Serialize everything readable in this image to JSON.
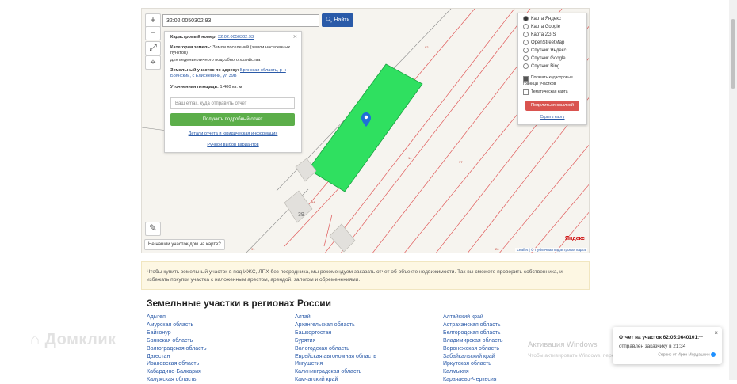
{
  "map": {
    "search_value": "32:02:0050302:93",
    "search_button": "Найти",
    "zoom_in": "+",
    "zoom_out": "−",
    "not_found_button": "Не нашли участок/дом на карте?",
    "parcel_numbers": [
      "92",
      "14",
      "97",
      "94",
      "91",
      "26"
    ],
    "house_number": "39",
    "attribution": "Leaflet | © Публичная кадастровая карта",
    "yandex_logo": "Яндекс",
    "parcel_color": "#2fe060"
  },
  "info": {
    "cadastral_label": "Кадастровый номер:",
    "cadastral_value": "32:02:0050302:93",
    "category_label": "Категория земель:",
    "category_value": "Земли поселений (земли населенных пунктов)",
    "usage": "для ведения личного подсобного хозяйства",
    "address_label": "Земельный участок по адресу:",
    "address_value": "Брянская область, р-н Брянский, с Елисеевичи, ул 39В",
    "area_label": "Уточненная площадь:",
    "area_value": "1 400 кв. м",
    "email_placeholder": "Ваш email, куда отправить отчет",
    "report_button": "Получить подробный отчет",
    "details_link": "Детали отчета и юридическая информация",
    "manual_link": "Ручной выбор вариантов",
    "close": "×"
  },
  "layers": {
    "options": [
      {
        "label": "Карта Яндекс",
        "selected": true
      },
      {
        "label": "Карта Google",
        "selected": false
      },
      {
        "label": "Карта 2GIS",
        "selected": false
      },
      {
        "label": "OpenStreetMap",
        "selected": false
      },
      {
        "label": "Спутник Яндекс",
        "selected": false
      },
      {
        "label": "Спутник Google",
        "selected": false
      },
      {
        "label": "Спутник Bing",
        "selected": false
      }
    ],
    "show_boundaries": "Показать кадастровые границы участков",
    "thematic": "Тематическая карта",
    "share_button": "Поделиться ссылкой",
    "report_error": "Сообщить об ошибке",
    "hide": "Скрыть карту"
  },
  "notice": "Чтобы купить земельный участок в под ИЖС, ЛПХ без посредника, мы рекомендуем заказать отчет об объекте недвижимости. Так вы сможете проверить собственника, и избежать покупки участка с наложенным арестом, арендой, залогом и обременениями.",
  "regions": {
    "title": "Земельные участки в регионах России",
    "col1": [
      "Адыгея",
      "Амурская область",
      "Байконур",
      "Брянская область",
      "Волгоградская область",
      "Дагестан",
      "Ивановская область",
      "Кабардино-Балкария",
      "Калужская область"
    ],
    "col2": [
      "Алтай",
      "Архангельская область",
      "Башкортостан",
      "Бурятия",
      "Вологодская область",
      "Еврейская автономная область",
      "Ингушетия",
      "Калининградская область",
      "Камчатский край"
    ],
    "col3": [
      "Алтайский край",
      "Астраханская область",
      "Белгородская область",
      "Владимирская область",
      "Воронежская область",
      "Забайкальский край",
      "Иркутская область",
      "Калмыкия",
      "Карачаево-Черкесия"
    ]
  },
  "toast": {
    "title": "Отчет на участок 62:05:0640101:",
    "title_suffix": "***",
    "subtitle": "отправлен заказчику в 21:34",
    "brand": "Сервис от Ирен Мордашкин",
    "close": "×"
  },
  "watermark": "Домклик",
  "windows": {
    "activate": "Активация Windows",
    "hint": "Чтобы активировать Windows, перейдите в раздел"
  }
}
